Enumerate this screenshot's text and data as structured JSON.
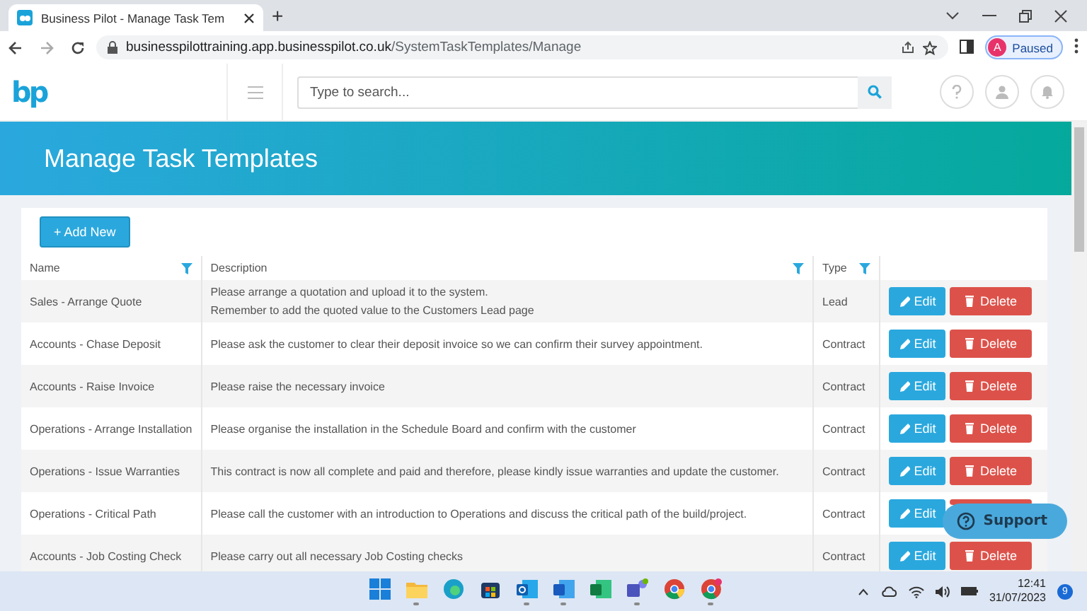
{
  "browser": {
    "tab_title": "Business Pilot - Manage Task Tem",
    "new_tab": "+",
    "url_domain": "businesspilottraining.app.businesspilot.co.uk",
    "url_path": "/SystemTaskTemplates/Manage",
    "profile_initial": "A",
    "profile_status": "Paused"
  },
  "header": {
    "logo": "bp",
    "search": {
      "placeholder": "Type to search..."
    }
  },
  "page": {
    "title": "Manage Task Templates",
    "add_button": "+ Add New"
  },
  "table": {
    "columns": [
      {
        "label": "Name"
      },
      {
        "label": "Description"
      },
      {
        "label": "Type"
      }
    ],
    "rows": [
      {
        "name": "Sales - Arrange Quote",
        "description": [
          "Please arrange a quotation and upload it to the system.",
          "Remember to add the quoted value to the Customers Lead page"
        ],
        "type": "Lead",
        "actions": [
          {
            "kind": "edit",
            "label": "Edit"
          },
          {
            "kind": "delete",
            "label": "Delete"
          }
        ]
      },
      {
        "name": "Accounts - Chase Deposit",
        "description": [
          "Please ask the customer to clear their deposit invoice so we can confirm their survey appointment."
        ],
        "type": "Contract",
        "actions": [
          {
            "kind": "edit",
            "label": "Edit"
          },
          {
            "kind": "delete",
            "label": "Delete"
          }
        ]
      },
      {
        "name": "Accounts - Raise Invoice",
        "description": [
          "Please raise the necessary invoice"
        ],
        "type": "Contract",
        "actions": [
          {
            "kind": "edit",
            "label": "Edit"
          },
          {
            "kind": "delete",
            "label": "Delete"
          }
        ]
      },
      {
        "name": "Operations - Arrange Installation",
        "description": [
          "Please organise the installation in the Schedule Board and confirm with the customer"
        ],
        "type": "Contract",
        "actions": [
          {
            "kind": "edit",
            "label": "Edit"
          },
          {
            "kind": "delete",
            "label": "Delete"
          }
        ]
      },
      {
        "name": "Operations - Issue Warranties",
        "description": [
          "This contract is now all complete and paid and therefore, please kindly issue warranties and update the customer."
        ],
        "type": "Contract",
        "actions": [
          {
            "kind": "edit",
            "label": "Edit"
          },
          {
            "kind": "delete",
            "label": "Delete"
          }
        ]
      },
      {
        "name": "Operations - Critical Path",
        "description": [
          "Please call the customer with an introduction to Operations and discuss the critical path of the build/project."
        ],
        "type": "Contract",
        "actions": [
          {
            "kind": "edit",
            "label": "Edit"
          },
          {
            "kind": "delete"
          }
        ]
      },
      {
        "name": "Accounts - Job Costing Check",
        "description": [
          "Please carry out all necessary Job Costing checks"
        ],
        "type": "Contract",
        "actions": [
          {
            "kind": "edit",
            "label": "Edit"
          },
          {
            "kind": "delete",
            "label": "Delete"
          }
        ]
      }
    ]
  },
  "support_button": "Support",
  "taskbar": {
    "apps": [
      {
        "kind": "start"
      },
      {
        "kind": "folder",
        "running": true
      },
      {
        "kind": "edge",
        "running": false
      },
      {
        "kind": "store",
        "running": false
      },
      {
        "kind": "outlook",
        "running": true
      },
      {
        "kind": "word",
        "running": true
      },
      {
        "kind": "excel",
        "running": false
      },
      {
        "kind": "teams",
        "running": true
      },
      {
        "kind": "chrome",
        "running": false
      },
      {
        "kind": "chrome-profile",
        "running": true
      }
    ],
    "time": "12:41",
    "date": "31/07/2023",
    "notifications": "9"
  }
}
